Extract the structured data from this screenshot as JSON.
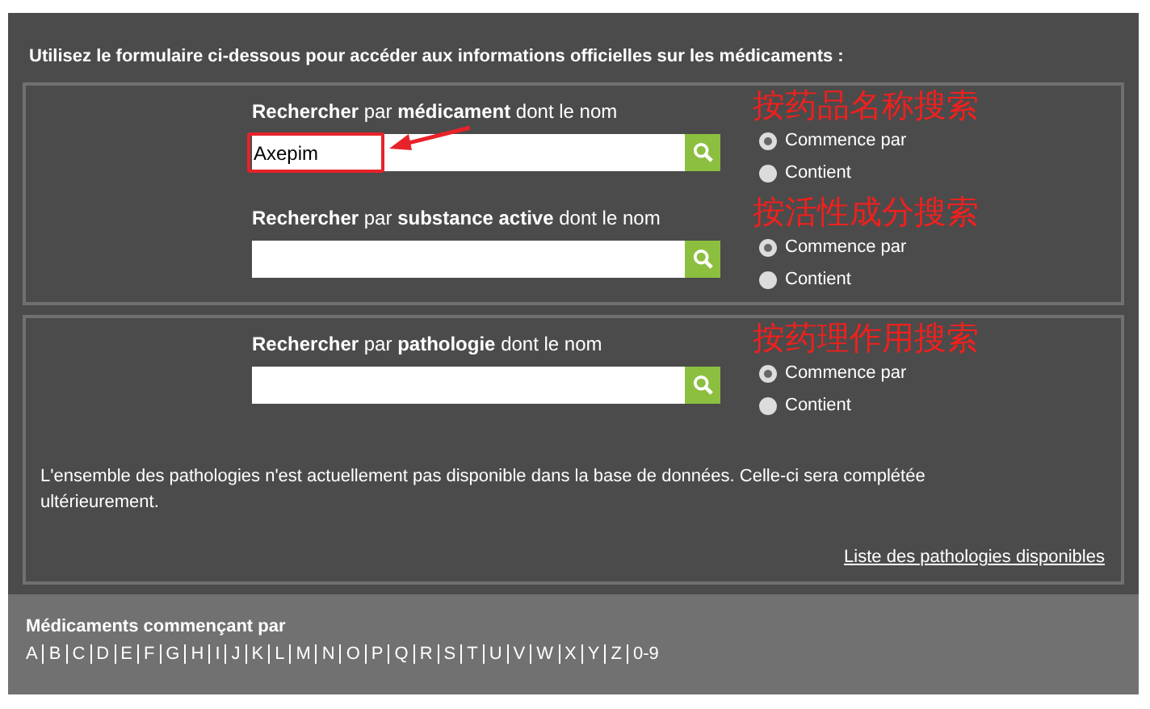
{
  "intro": "Utilisez le formulaire ci-dessous pour accéder aux informations officielles sur les médicaments :",
  "boxes": [
    {
      "sections": [
        {
          "label": "**Rechercher** par **médicament** dont le nom",
          "value": "Axepim",
          "highlighted": true,
          "annotation": "按药品名称搜索",
          "options": [
            {
              "label": "Commence par",
              "selected": true
            },
            {
              "label": "Contient",
              "selected": false
            }
          ]
        },
        {
          "label": "**Rechercher** par **substance active** dont le nom",
          "highlighted": false,
          "annotation": "按活性成分搜索",
          "options": [
            {
              "label": "Commence par",
              "selected": true
            },
            {
              "label": "Contient",
              "selected": false
            }
          ]
        }
      ]
    },
    {
      "sections": [
        {
          "label": "**Rechercher** par **pathologie** dont le nom",
          "highlighted": false,
          "annotation": "按药理作用搜索",
          "options": [
            {
              "label": "Commence par",
              "selected": true
            },
            {
              "label": "Contient",
              "selected": false
            }
          ]
        }
      ],
      "note": "L'ensemble des pathologies n'est actuellement pas disponible dans la base de données. Celle-ci sera complétée ultérieurement.",
      "link": "Liste des pathologies disponibles"
    }
  ],
  "letters_title": "Médicaments commençant par",
  "letters": [
    "A",
    "B",
    "C",
    "D",
    "E",
    "F",
    "G",
    "H",
    "I",
    "J",
    "K",
    "L",
    "M",
    "N",
    "O",
    "P",
    "Q",
    "R",
    "S",
    "T",
    "U",
    "V",
    "W",
    "X",
    "Y",
    "Z",
    "0-9"
  ]
}
